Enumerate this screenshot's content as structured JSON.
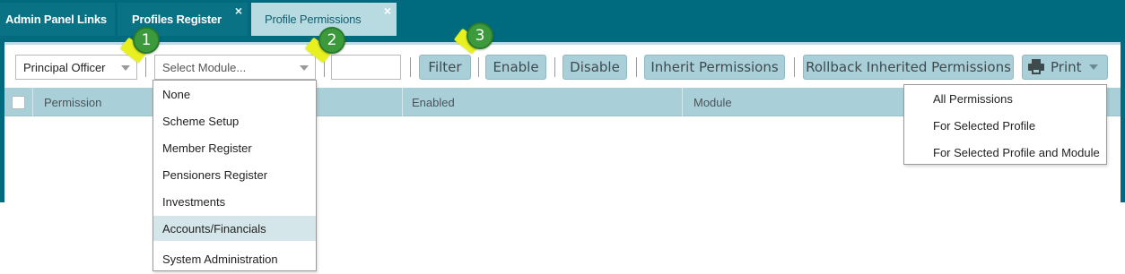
{
  "tabs": [
    {
      "label": "Admin Panel Links",
      "closable": false,
      "active": false
    },
    {
      "label": "Profiles Register",
      "closable": true,
      "active": false
    },
    {
      "label": "Profile Permissions",
      "closable": true,
      "active": true
    }
  ],
  "tab_close_glyph": "×",
  "toolbar": {
    "officer_select_value": "Principal Officer",
    "module_select_placeholder": "Select Module...",
    "filter_text_value": "",
    "filter_label": "Filter",
    "enable_label": "Enable",
    "disable_label": "Disable",
    "inherit_label": "Inherit Permissions",
    "rollback_label": "Rollback Inherited Permissions",
    "print_label": "Print"
  },
  "grid": {
    "columns": [
      "Permission",
      "Enabled",
      "Module"
    ]
  },
  "module_dropdown": {
    "options": [
      "None",
      "Scheme Setup",
      "Member Register",
      "Pensioners Register",
      "Investments",
      "Accounts/Financials",
      "System Administration"
    ],
    "highlighted": "Accounts/Financials"
  },
  "print_menu": {
    "options": [
      "All Permissions",
      "For Selected Profile",
      "For Selected Profile and Module"
    ]
  },
  "callouts": [
    "1",
    "2",
    "3"
  ],
  "colors": {
    "header_teal": "#006b7e",
    "button_bg": "#a9cfd8",
    "active_tab": "#b8dbe2",
    "badge_green": "#3c9a3c",
    "arrow_yellow": "#e8f020"
  }
}
